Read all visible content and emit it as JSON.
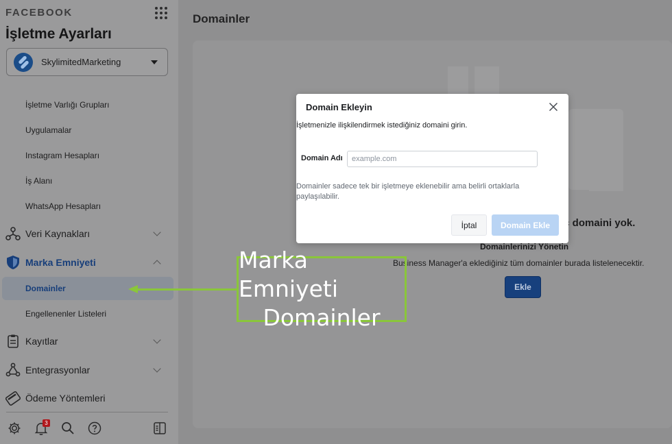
{
  "brand": "FACEBOOK",
  "sidebar": {
    "title": "İşletme Ayarları",
    "account": "SkylimitedMarketing",
    "sub_items": [
      "İşletme Varlığı Grupları",
      "Uygulamalar",
      "Instagram Hesapları",
      "İş Alanı",
      "WhatsApp Hesapları"
    ],
    "sections": {
      "veri": "Veri Kaynakları",
      "marka": "Marka Emniyeti",
      "domainler": "Domainler",
      "engellenen": "Engellenenler Listeleri",
      "kayitlar": "Kayıtlar",
      "entegrasyon": "Entegrasyonlar",
      "odeme": "Ödeme Yöntemleri"
    },
    "notification_count": "3"
  },
  "main": {
    "heading": "Domainler",
    "empty_title": "iç domaini yok.",
    "manage_title": "Domainlerinizi Yönetin",
    "manage_desc": "Business Manager'a eklediğiniz tüm domainler burada listelenecektir.",
    "add_button": "Ekle"
  },
  "modal": {
    "title": "Domain Ekleyin",
    "description": "İşletmenizle ilişkilendirmek istediğiniz domaini girin.",
    "field_label": "Domain Adı",
    "placeholder": "example.com",
    "note": "Domainler sadece tek bir işletmeye eklenebilir ama belirli ortaklarla paylaşılabilir.",
    "cancel": "İptal",
    "confirm": "Domain Ekle"
  },
  "annotation": {
    "line1": "Marka Emniyeti",
    "line2": "Domainler",
    "color": "#8ac63a"
  },
  "colors": {
    "accent": "#17407d",
    "annotation": "#8ac63a"
  }
}
